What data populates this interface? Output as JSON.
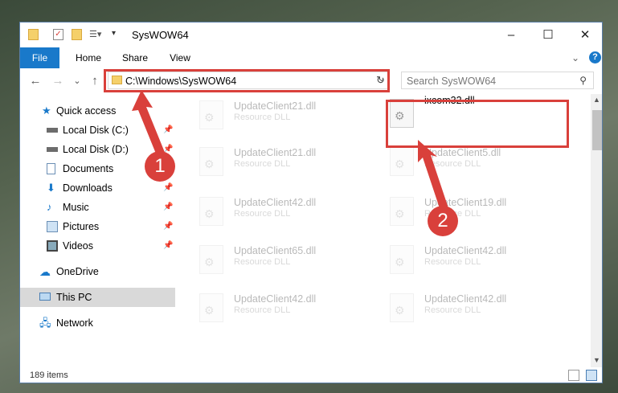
{
  "window": {
    "title": "SysWOW64",
    "controls": {
      "minimize": "–",
      "maximize": "☐",
      "close": "✕"
    }
  },
  "ribbon": {
    "tabs": [
      "File",
      "Home",
      "Share",
      "View"
    ],
    "expand": "⌄",
    "help": "?"
  },
  "nav": {
    "back": "←",
    "forward": "→",
    "recent": "⌄",
    "up": "↑"
  },
  "address": {
    "path": "C:\\Windows\\SysWOW64",
    "dropdown": "⌄",
    "refresh": "↻"
  },
  "search": {
    "placeholder": "Search SysWOW64"
  },
  "sidebar": {
    "items": [
      {
        "label": "Quick access"
      },
      {
        "label": "Local Disk (C:)"
      },
      {
        "label": "Local Disk (D:)"
      },
      {
        "label": "Documents"
      },
      {
        "label": "Downloads"
      },
      {
        "label": "Music"
      },
      {
        "label": "Pictures"
      },
      {
        "label": "Videos"
      },
      {
        "label": "OneDrive"
      },
      {
        "label": "This PC"
      },
      {
        "label": "Network"
      }
    ]
  },
  "files": [
    {
      "name": "UpdateClient21.dll",
      "type": "Resource DLL"
    },
    {
      "name": "ixcom32.dll",
      "type": ""
    },
    {
      "name": "UpdateClient21.dll",
      "type": "Resource DLL"
    },
    {
      "name": "UpdateClient5.dll",
      "type": "Resource DLL"
    },
    {
      "name": "UpdateClient42.dll",
      "type": "Resource DLL"
    },
    {
      "name": "UpdateClient19.dll",
      "type": "Resource DLL"
    },
    {
      "name": "UpdateClient65.dll",
      "type": "Resource DLL"
    },
    {
      "name": "UpdateClient42.dll",
      "type": "Resource DLL"
    },
    {
      "name": "UpdateClient42.dll",
      "type": "Resource DLL"
    },
    {
      "name": "UpdateClient42.dll",
      "type": "Resource DLL"
    }
  ],
  "status": {
    "count": "189 items"
  },
  "annotations": {
    "step1": "1",
    "step2": "2",
    "color": "#d9403b"
  }
}
